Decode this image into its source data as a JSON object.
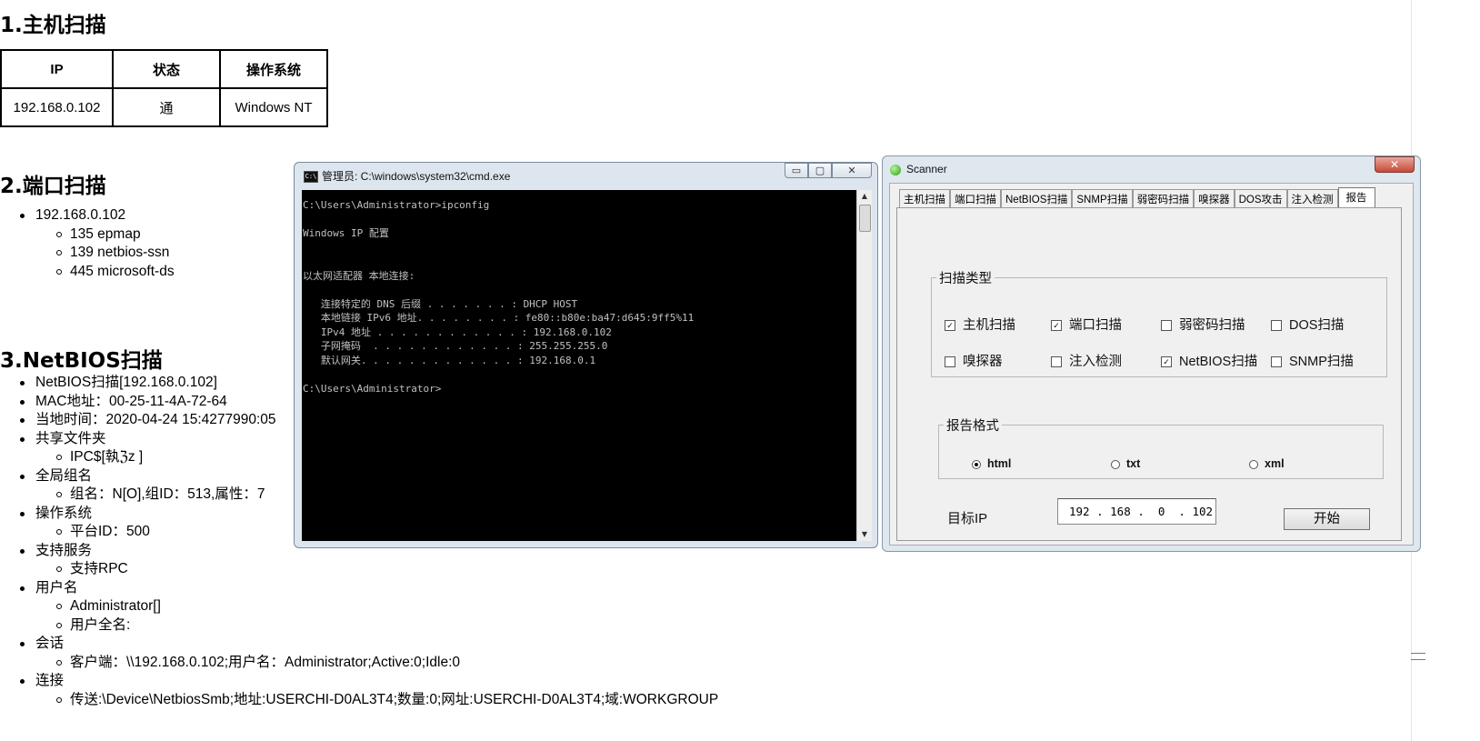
{
  "report": {
    "section1": {
      "title": "1.主机扫描",
      "headers": [
        "IP",
        "状态",
        "操作系统"
      ],
      "row": [
        "192.168.0.102",
        "通",
        "Windows NT"
      ]
    },
    "section2": {
      "title": "2.端口扫描",
      "host": "192.168.0.102",
      "ports": [
        "135 epmap",
        "139 netbios-ssn",
        "445 microsoft-ds"
      ]
    },
    "section3": {
      "title": "3.NetBIOS扫描",
      "items": [
        {
          "label": "NetBIOS扫描[192.168.0.102]",
          "sub": []
        },
        {
          "label": "MAC地址：00-25-11-4A-72-64",
          "sub": []
        },
        {
          "label": "当地时间：2020-04-24 15:4277990:05",
          "sub": []
        },
        {
          "label": "共享文件夹",
          "sub": [
            "IPC$[執ℨz ]"
          ]
        },
        {
          "label": "全局组名",
          "sub": [
            "组名：N[O],组ID：513,属性：7"
          ]
        },
        {
          "label": "操作系统",
          "sub": [
            "平台ID：500"
          ]
        },
        {
          "label": "支持服务",
          "sub": [
            "支持RPC"
          ]
        },
        {
          "label": "用户名",
          "sub": [
            "Administrator[]",
            "用户全名:"
          ]
        },
        {
          "label": "会话",
          "sub": [
            "客户端：\\\\192.168.0.102;用户名：Administrator;Active:0;Idle:0"
          ]
        },
        {
          "label": "连接",
          "sub": [
            "传送:\\Device\\NetbiosSmb;地址:USERCHI-D0AL3T4;数量:0;网址:USERCHI-D0AL3T4;域:WORKGROUP"
          ]
        }
      ]
    }
  },
  "cmd": {
    "title": "管理员: C:\\windows\\system32\\cmd.exe",
    "icon": "cmd-icon",
    "buttons": {
      "minimize": "▭",
      "maximize": "▢",
      "close": "✕"
    },
    "lines": [
      "C:\\Users\\Administrator>ipconfig",
      "",
      "Windows IP 配置",
      "",
      "",
      "以太网适配器 本地连接:",
      "",
      "   连接特定的 DNS 后缀 . . . . . . . : DHCP HOST",
      "   本地链接 IPv6 地址. . . . . . . . : fe80::b80e:ba47:d645:9ff5%11",
      "   IPv4 地址 . . . . . . . . . . . . : 192.168.0.102",
      "   子网掩码  . . . . . . . . . . . . : 255.255.255.0",
      "   默认网关. . . . . . . . . . . . . : 192.168.0.1",
      "",
      "C:\\Users\\Administrator>"
    ]
  },
  "scanner": {
    "title": "Scanner",
    "close": "✕",
    "tabs": [
      "主机扫描",
      "端口扫描",
      "NetBIOS扫描",
      "SNMP扫描",
      "弱密码扫描",
      "嗅探器",
      "DOS攻击",
      "注入检测",
      "报告"
    ],
    "active_tab": "报告",
    "scan_type": {
      "legend": "扫描类型",
      "options": [
        {
          "label": "主机扫描",
          "checked": true
        },
        {
          "label": "端口扫描",
          "checked": true
        },
        {
          "label": "弱密码扫描",
          "checked": false
        },
        {
          "label": "DOS扫描",
          "checked": false
        },
        {
          "label": "嗅探器",
          "checked": false
        },
        {
          "label": "注入检测",
          "checked": false
        },
        {
          "label": "NetBIOS扫描",
          "checked": true
        },
        {
          "label": "SNMP扫描",
          "checked": false
        }
      ]
    },
    "report_format": {
      "legend": "报告格式",
      "options": [
        {
          "label": "html",
          "selected": true
        },
        {
          "label": "txt",
          "selected": false
        },
        {
          "label": "xml",
          "selected": false
        }
      ]
    },
    "target_ip_label": "目标IP",
    "target_ip": "192 . 168 .  0  . 102",
    "start_button": "开始"
  }
}
